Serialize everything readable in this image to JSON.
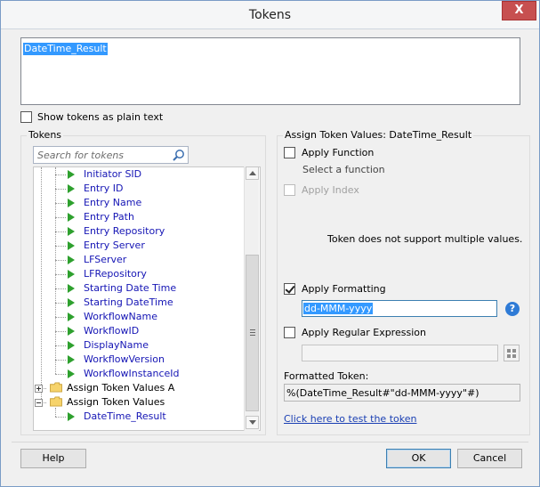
{
  "window": {
    "title": "Tokens",
    "close_glyph": "X"
  },
  "editor": {
    "content": "DateTime_Result"
  },
  "show_plain": {
    "label": "Show tokens as plain text",
    "checked": false
  },
  "tokens_panel": {
    "caption": "Tokens",
    "search_placeholder": "Search for tokens",
    "leaf_items": [
      "Initiator SID",
      "Entry ID",
      "Entry Name",
      "Entry Path",
      "Entry Repository",
      "Entry Server",
      "LFServer",
      "LFRepository",
      "Starting Date Time",
      "Starting DateTime",
      "WorkflowName",
      "WorkflowID",
      "DisplayName",
      "WorkflowVersion",
      "WorkflowInstanceId"
    ],
    "group_a": "Assign Token Values A",
    "group_b": "Assign Token Values",
    "group_b_child": "DateTime_Result"
  },
  "assign_panel": {
    "caption": "Assign Token Values: DateTime_Result",
    "apply_function": "Apply Function",
    "select_function": "Select a function",
    "apply_index": "Apply Index",
    "no_multiple": "Token does not support multiple values.",
    "apply_formatting": "Apply Formatting",
    "formatting_value": "dd-MMM-yyyy",
    "help_glyph": "?",
    "apply_regex": "Apply Regular Expression",
    "formatted_label": "Formatted Token:",
    "formatted_value": "%(DateTime_Result#\"dd-MMM-yyyy\"#)",
    "test_link": "Click here to test the token"
  },
  "buttons": {
    "help": "Help",
    "ok": "OK",
    "cancel": "Cancel"
  },
  "colors": {
    "accent": "#3399ff",
    "link": "#1a3fb3",
    "tree_text": "#1515b5",
    "arrow": "#2ea02e",
    "close": "#c75050"
  }
}
